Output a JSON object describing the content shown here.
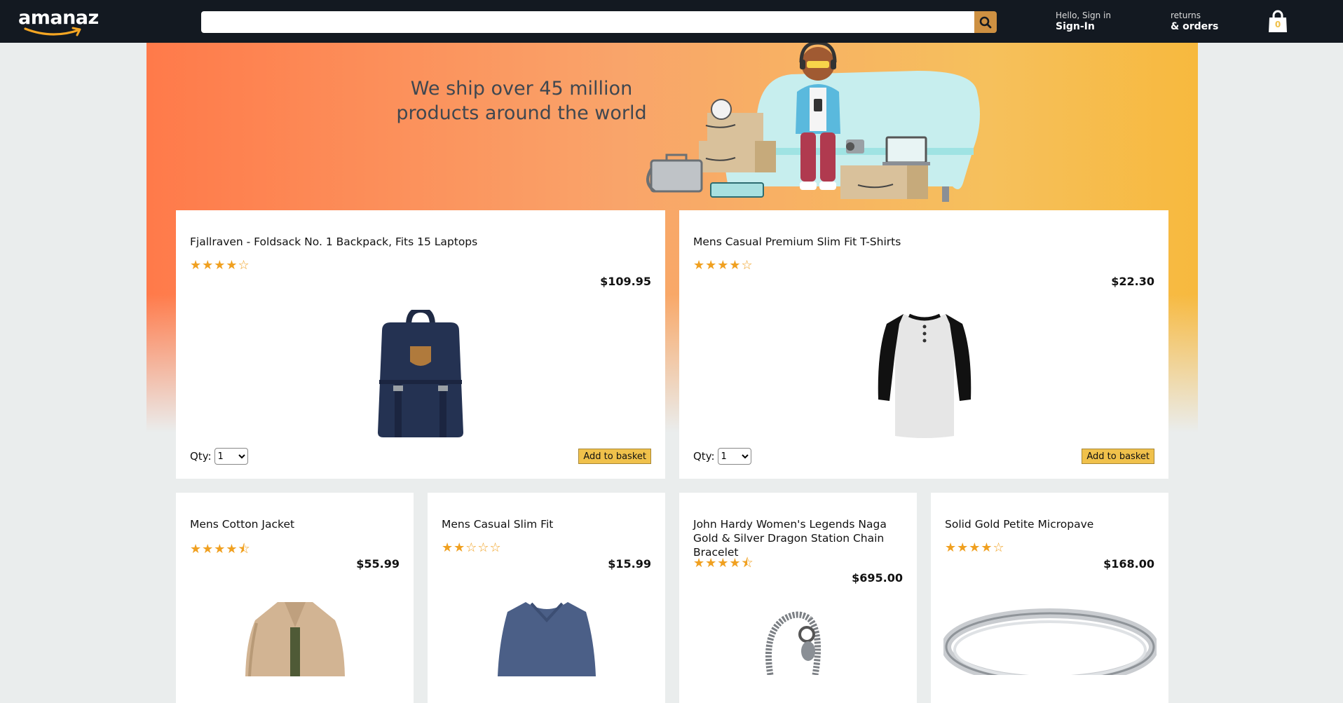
{
  "header": {
    "logo_text": "amanaz",
    "search": {
      "value": "",
      "placeholder": ""
    },
    "signin": {
      "line1": "Hello, Sign in",
      "line2": "Sign-In"
    },
    "orders": {
      "line1": "returns",
      "line2": "& orders"
    },
    "basket_count": "0",
    "colors": {
      "bar": "#131921",
      "search_button": "#cd9042",
      "logo_arrow": "#f5a623"
    }
  },
  "hero": {
    "line1": "We ship over 45 million",
    "line2": "products around the world"
  },
  "products": [
    {
      "title": "Fjallraven - Foldsack No. 1 Backpack, Fits 15 Laptops",
      "stars": "★★★★☆",
      "rating": 4,
      "price": "$109.95",
      "qty_label": "Qty:",
      "qty": "1",
      "button": "Add to basket",
      "image": "backpack"
    },
    {
      "title": "Mens Casual Premium Slim Fit T-Shirts",
      "stars": "★★★★☆",
      "rating": 4,
      "price": "$22.30",
      "qty_label": "Qty:",
      "qty": "1",
      "button": "Add to basket",
      "image": "raglan-tshirt"
    },
    {
      "title": "Mens Cotton Jacket",
      "stars": "★★★★⯪",
      "rating": 4.5,
      "price": "$55.99",
      "image": "jacket"
    },
    {
      "title": "Mens Casual Slim Fit",
      "stars": "★★☆☆☆",
      "rating": 2,
      "price": "$15.99",
      "image": "longsleeve-shirt"
    },
    {
      "title": "John Hardy Women's Legends Naga Gold & Silver Dragon Station Chain Bracelet",
      "stars": "★★★★⯪",
      "rating": 4.5,
      "price": "$695.00",
      "image": "dragon-bracelet"
    },
    {
      "title": "Solid Gold Petite Micropave",
      "stars": "★★★★☆",
      "rating": 4,
      "price": "$168.00",
      "image": "ring"
    }
  ]
}
